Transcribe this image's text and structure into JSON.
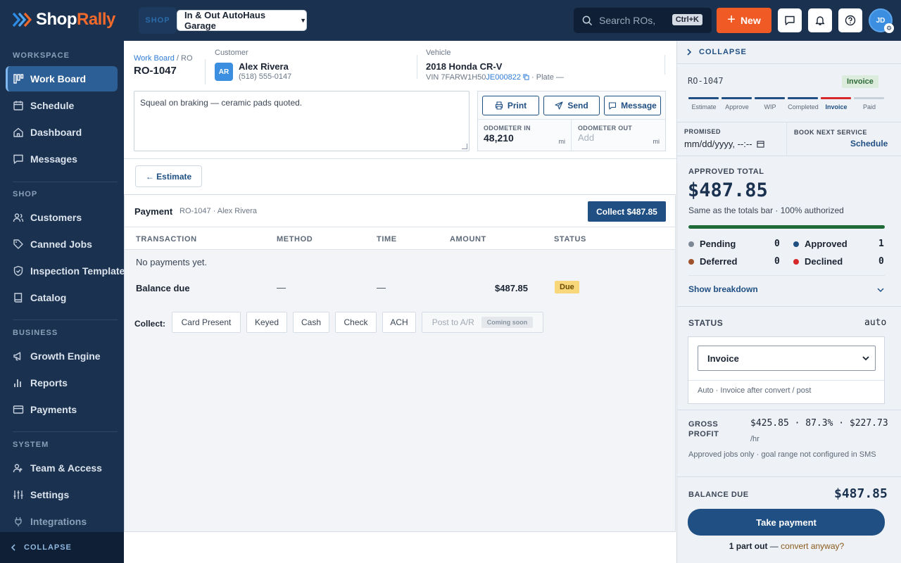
{
  "header": {
    "brand": "ShopRally",
    "shop_tag": "SHOP",
    "shop_name": "In & Out AutoHaus Garage",
    "search_placeholder": "Search ROs,",
    "search_shortcut": "Ctrl+K",
    "new_label": "New",
    "avatar_initials": "JD",
    "colors": {
      "bg": "#1a3150",
      "accent": "#f05a24"
    }
  },
  "sidebar": {
    "sections": [
      "WORKSPACE",
      "SHOP",
      "BUSINESS",
      "SYSTEM"
    ],
    "items": [
      {
        "label": "Work Board",
        "icon": "board-icon",
        "active": true
      },
      {
        "label": "Schedule",
        "icon": "calendar-icon"
      },
      {
        "label": "Dashboard",
        "icon": "home-icon"
      },
      {
        "label": "Messages",
        "icon": "chat-icon"
      },
      {
        "label": "Customers",
        "icon": "users-icon"
      },
      {
        "label": "Canned Jobs",
        "icon": "tag-icon"
      },
      {
        "label": "Inspection Templates",
        "icon": "shield-check-icon"
      },
      {
        "label": "Catalog",
        "icon": "book-icon"
      },
      {
        "label": "Growth Engine",
        "icon": "megaphone-icon"
      },
      {
        "label": "Reports",
        "icon": "bar-chart-icon"
      },
      {
        "label": "Payments",
        "icon": "card-icon"
      },
      {
        "label": "Team & Access",
        "icon": "team-icon"
      },
      {
        "label": "Settings",
        "icon": "sliders-icon"
      },
      {
        "label": "Integrations",
        "icon": "plug-icon"
      }
    ],
    "collapse_label": "COLLAPSE"
  },
  "ro": {
    "breadcrumb_link": "Work Board",
    "breadcrumb_rest": " / RO",
    "number": "RO-1047",
    "customer_label": "Customer",
    "customer_initials": "AR",
    "customer_name": "Alex Rivera",
    "customer_phone": "(518) 555-0147",
    "vehicle_label": "Vehicle",
    "vehicle_name": "2018 Honda CR-V",
    "vin_prefix": "VIN 7FARW1H50",
    "vin_highlight": "JE000822",
    "vin_suffix": " · Plate —",
    "notes": "Squeal on braking — ceramic pads quoted.",
    "actions": {
      "print": "Print",
      "send": "Send",
      "message": "Message"
    },
    "odometer_in_label": "ODOMETER IN",
    "odometer_in_value": "48,210",
    "odometer_out_label": "ODOMETER OUT",
    "odometer_out_placeholder": "Add",
    "unit": "mi",
    "estimate_btn": "← Estimate"
  },
  "payment": {
    "title": "Payment",
    "subtitle": "RO-1047 · Alex Rivera",
    "collect_btn": "Collect $487.85",
    "columns": [
      "TRANSACTION",
      "METHOD",
      "TIME",
      "AMOUNT",
      "STATUS"
    ],
    "empty_text": "No payments yet.",
    "balance_label": "Balance due",
    "balance_method": "—",
    "balance_time": "—",
    "balance_amount": "$487.85",
    "balance_status": "Due",
    "collect_label": "Collect:",
    "methods": [
      "Card Present",
      "Keyed",
      "Cash",
      "Check",
      "ACH"
    ],
    "ar_label": "Post to A/R",
    "ar_badge": "Coming soon"
  },
  "right_panel": {
    "collapse_label": "COLLAPSE",
    "ro_code": "RO-1047",
    "stage_badge": "Invoice",
    "stages": [
      "Estimate",
      "Approve",
      "WIP",
      "Completed",
      "Invoice",
      "Paid"
    ],
    "promised_label": "PROMISED",
    "promised_placeholder": "mm/dd/yyyy, --:--",
    "book_label": "BOOK NEXT SERVICE",
    "book_link": "Schedule",
    "approved_total_label": "APPROVED TOTAL",
    "approved_total": "$487.85",
    "approved_sub": "Same as the totals bar · 100% authorized",
    "counts": [
      {
        "label": "Pending",
        "value": "0",
        "color": "#7d8896"
      },
      {
        "label": "Approved",
        "value": "1",
        "color": "#1f4f83"
      },
      {
        "label": "Deferred",
        "value": "0",
        "color": "#a0522d"
      },
      {
        "label": "Declined",
        "value": "0",
        "color": "#d62828"
      }
    ],
    "show_breakdown": "Show breakdown",
    "status_label": "STATUS",
    "status_mode": "auto",
    "status_value": "Invoice",
    "status_note": "Auto · Invoice after convert / post",
    "gp_label_1": "GROSS",
    "gp_label_2": "PROFIT",
    "gp_value": "$425.85 · 87.3% · $227.73",
    "gp_unit": "/hr",
    "gp_note": "Approved jobs only · goal range not configured in SMS",
    "balance_label": "BALANCE DUE",
    "balance_value": "$487.85",
    "take_payment": "Take payment",
    "part_out_bold": "1 part out",
    "part_out_dash": " — ",
    "part_out_link": "convert anyway?"
  }
}
